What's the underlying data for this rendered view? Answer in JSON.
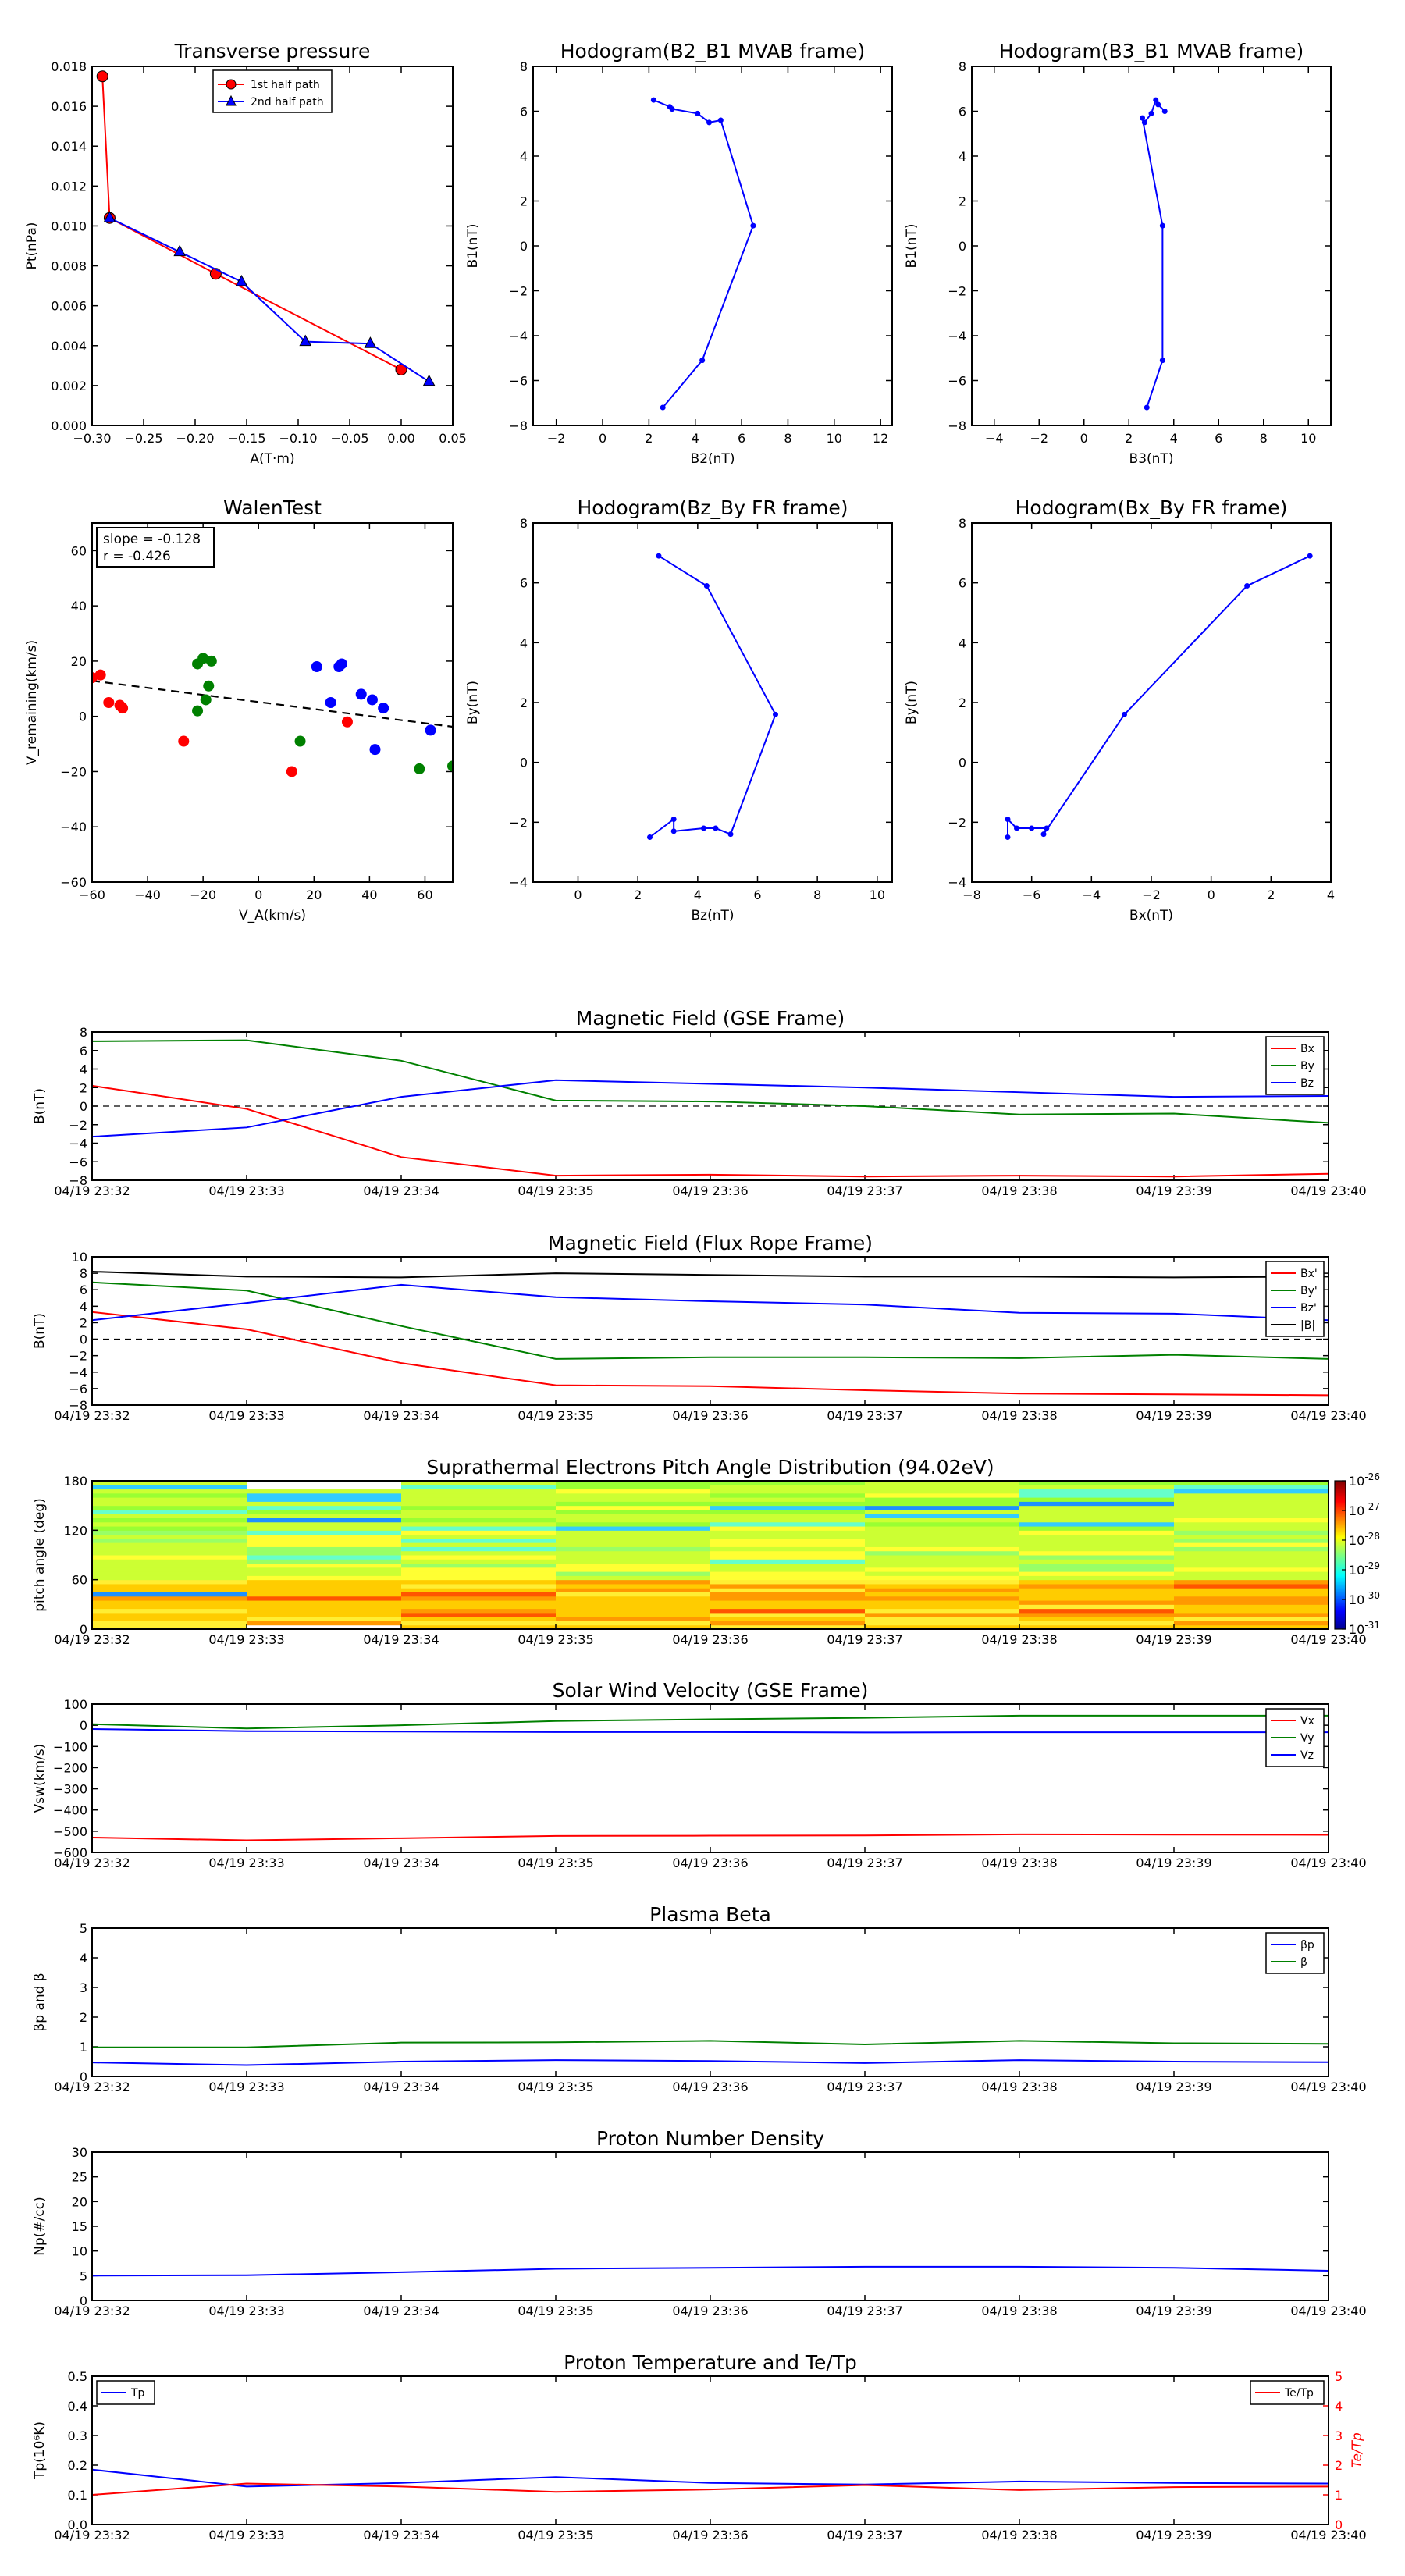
{
  "figure": {
    "time_ticks": [
      "04/19 23:32",
      "04/19 23:33",
      "04/19 23:34",
      "04/19 23:35",
      "04/19 23:36",
      "04/19 23:37",
      "04/19 23:38",
      "04/19 23:39",
      "04/19 23:40"
    ]
  },
  "chart_data": [
    {
      "id": "tp",
      "type": "line",
      "title": "Transverse pressure",
      "xlabel": "A(T·m)",
      "ylabel": "Pt(nPa)",
      "xlim": [
        -0.3,
        0.05
      ],
      "ylim": [
        0,
        0.018
      ],
      "xticks": [
        -0.3,
        -0.25,
        -0.2,
        -0.15,
        -0.1,
        -0.05,
        0.0,
        0.05
      ],
      "xtick_labels": [
        "−0.30",
        "−0.25",
        "−0.20",
        "−0.15",
        "−0.10",
        "−0.05",
        "0.00",
        "0.05"
      ],
      "yticks": [
        0,
        0.002,
        0.004,
        0.006,
        0.008,
        0.01,
        0.012,
        0.014,
        0.016,
        0.018
      ],
      "ytick_labels": [
        "0.000",
        "0.002",
        "0.004",
        "0.006",
        "0.008",
        "0.010",
        "0.012",
        "0.014",
        "0.016",
        "0.018"
      ],
      "legend": "top-center",
      "series": [
        {
          "name": "1st half path",
          "color": "#ff0000",
          "marker": "circle",
          "x": [
            0.0,
            -0.18,
            -0.283,
            -0.29
          ],
          "y": [
            0.0028,
            0.0076,
            0.0104,
            0.0175
          ]
        },
        {
          "name": "2nd half path",
          "color": "#0000ff",
          "marker": "triangle",
          "x": [
            0.027,
            -0.03,
            -0.093,
            -0.155,
            -0.215,
            -0.283
          ],
          "y": [
            0.0022,
            0.0041,
            0.0042,
            0.0072,
            0.0087,
            0.0104
          ]
        }
      ]
    },
    {
      "id": "h21",
      "type": "line",
      "title": "Hodogram(B2_B1 MVAB frame)",
      "xlabel": "B2(nT)",
      "ylabel": "B1(nT)",
      "xlim": [
        -3,
        12.5
      ],
      "ylim": [
        -8,
        8
      ],
      "xticks": [
        -2,
        0,
        2,
        4,
        6,
        8,
        10,
        12
      ],
      "yticks": [
        -8,
        -6,
        -4,
        -2,
        0,
        2,
        4,
        6,
        8
      ],
      "series": [
        {
          "color": "#0000ff",
          "marker": "dot",
          "x": [
            2.2,
            2.9,
            3.0,
            4.1,
            4.6,
            5.1,
            6.5,
            4.3,
            2.6
          ],
          "y": [
            6.5,
            6.2,
            6.1,
            5.9,
            5.5,
            5.6,
            0.9,
            -5.1,
            -7.2
          ]
        }
      ]
    },
    {
      "id": "h31",
      "type": "line",
      "title": "Hodogram(B3_B1 MVAB frame)",
      "xlabel": "B3(nT)",
      "ylabel": "B1(nT)",
      "xlim": [
        -5,
        11
      ],
      "ylim": [
        -8,
        8
      ],
      "xticks": [
        -4,
        -2,
        0,
        2,
        4,
        6,
        8,
        10
      ],
      "yticks": [
        -8,
        -6,
        -4,
        -2,
        0,
        2,
        4,
        6,
        8
      ],
      "series": [
        {
          "color": "#0000ff",
          "marker": "dot",
          "x": [
            3.6,
            3.3,
            3.2,
            3.0,
            2.7,
            2.6,
            3.5,
            3.5,
            2.8
          ],
          "y": [
            6.0,
            6.3,
            6.5,
            5.9,
            5.5,
            5.7,
            0.9,
            -5.1,
            -7.2
          ]
        }
      ]
    },
    {
      "id": "walen",
      "type": "scatter",
      "title": "WalenTest",
      "xlabel": "V_A(km/s)",
      "ylabel": "V_remaining(km/s)",
      "xlim": [
        -60,
        70
      ],
      "ylim": [
        -60,
        70
      ],
      "xticks": [
        -60,
        -40,
        -20,
        0,
        20,
        40,
        60
      ],
      "yticks": [
        -60,
        -40,
        -20,
        0,
        20,
        40,
        60
      ],
      "annotation": [
        "slope = -0.128",
        "r = -0.426"
      ],
      "fit": {
        "slope": -0.128,
        "intercept": 5.2,
        "color": "#000000"
      },
      "series": [
        {
          "color": "#ff0000",
          "x": [
            -60,
            -57,
            -54,
            -50,
            -49,
            -27,
            12,
            32
          ],
          "y": [
            14,
            15,
            5,
            4,
            3,
            -9,
            -20,
            -2
          ]
        },
        {
          "color": "#008000",
          "x": [
            -22,
            -20,
            -18,
            -19,
            -17,
            -22,
            15,
            58,
            70
          ],
          "y": [
            19,
            21,
            11,
            6,
            20,
            2,
            -9,
            -19,
            -18
          ]
        },
        {
          "color": "#0000ff",
          "x": [
            21,
            26,
            29,
            30,
            37,
            41,
            42,
            45,
            62
          ],
          "y": [
            18,
            5,
            18,
            19,
            8,
            6,
            -12,
            3,
            -5
          ]
        }
      ]
    },
    {
      "id": "hzy",
      "type": "line",
      "title": "Hodogram(Bz_By FR frame)",
      "xlabel": "Bz(nT)",
      "ylabel": "By(nT)",
      "xlim": [
        -1.5,
        10.5
      ],
      "ylim": [
        -4,
        8
      ],
      "xticks": [
        0,
        2,
        4,
        6,
        8,
        10
      ],
      "yticks": [
        -4,
        -2,
        0,
        2,
        4,
        6,
        8
      ],
      "series": [
        {
          "color": "#0000ff",
          "marker": "dot",
          "x": [
            2.7,
            4.3,
            6.6,
            5.1,
            4.6,
            4.2,
            3.2,
            3.2,
            2.4
          ],
          "y": [
            6.9,
            5.9,
            1.6,
            -2.4,
            -2.2,
            -2.2,
            -2.3,
            -1.9,
            -2.5
          ]
        }
      ]
    },
    {
      "id": "hxy",
      "type": "line",
      "title": "Hodogram(Bx_By FR frame)",
      "xlabel": "Bx(nT)",
      "ylabel": "By(nT)",
      "xlim": [
        -8,
        4
      ],
      "ylim": [
        -4,
        8
      ],
      "xticks": [
        -8,
        -6,
        -4,
        -2,
        0,
        2,
        4
      ],
      "yticks": [
        -4,
        -2,
        0,
        2,
        4,
        6,
        8
      ],
      "series": [
        {
          "color": "#0000ff",
          "marker": "dot",
          "x": [
            3.3,
            1.2,
            -2.9,
            -5.6,
            -5.5,
            -6.0,
            -6.5,
            -6.8,
            -6.8
          ],
          "y": [
            6.9,
            5.9,
            1.6,
            -2.4,
            -2.2,
            -2.2,
            -2.2,
            -1.9,
            -2.5
          ]
        }
      ]
    },
    {
      "id": "mag_gse",
      "type": "line",
      "title": "Magnetic Field (GSE Frame)",
      "ylabel": "B(nT)",
      "ylim": [
        -8,
        8
      ],
      "yticks": [
        -8,
        -6,
        -4,
        -2,
        0,
        2,
        4,
        6,
        8
      ],
      "zero_line": true,
      "legend": "top-right",
      "series": [
        {
          "name": "Bx",
          "color": "#ff0000",
          "values": [
            2.2,
            -0.3,
            -5.5,
            -7.5,
            -7.4,
            -7.6,
            -7.5,
            -7.6,
            -7.3
          ]
        },
        {
          "name": "By",
          "color": "#008000",
          "values": [
            7.0,
            7.1,
            4.9,
            0.6,
            0.5,
            0.0,
            -0.9,
            -0.8,
            -1.8
          ]
        },
        {
          "name": "Bz",
          "color": "#0000ff",
          "values": [
            -3.3,
            -2.3,
            1.0,
            2.8,
            2.4,
            2.0,
            1.5,
            1.0,
            1.1
          ]
        }
      ]
    },
    {
      "id": "mag_fr",
      "type": "line",
      "title": "Magnetic Field (Flux Rope Frame)",
      "ylabel": "B(nT)",
      "ylim": [
        -8,
        10
      ],
      "yticks": [
        -8,
        -6,
        -4,
        -2,
        0,
        2,
        4,
        6,
        8,
        10
      ],
      "zero_line": true,
      "legend": "top-right",
      "series": [
        {
          "name": "Bx'",
          "color": "#ff0000",
          "values": [
            3.3,
            1.2,
            -2.9,
            -5.6,
            -5.7,
            -6.2,
            -6.6,
            -6.7,
            -6.8
          ]
        },
        {
          "name": "By'",
          "color": "#008000",
          "values": [
            6.9,
            5.9,
            1.6,
            -2.4,
            -2.2,
            -2.2,
            -2.3,
            -1.9,
            -2.4
          ]
        },
        {
          "name": "Bz'",
          "color": "#0000ff",
          "values": [
            2.3,
            4.4,
            6.6,
            5.1,
            4.6,
            4.2,
            3.2,
            3.1,
            2.3
          ]
        },
        {
          "name": "|B|",
          "color": "#000000",
          "values": [
            8.2,
            7.6,
            7.5,
            8.0,
            7.8,
            7.6,
            7.6,
            7.5,
            7.6
          ]
        }
      ]
    },
    {
      "id": "pad",
      "type": "heatmap",
      "title": "Suprathermal Electrons Pitch Angle Distribution (94.02eV)",
      "ylabel": "pitch angle (deg)",
      "ylim": [
        0,
        180
      ],
      "yticks": [
        0,
        60,
        120,
        180
      ],
      "colorbar_ticks": [
        "-26",
        "-27",
        "-28",
        "-29",
        "-30",
        "-31"
      ]
    },
    {
      "id": "vsw",
      "type": "line",
      "title": "Solar Wind Velocity (GSE Frame)",
      "ylabel": "Vsw(km/s)",
      "ylim": [
        -600,
        100
      ],
      "yticks": [
        -600,
        -500,
        -400,
        -300,
        -200,
        -100,
        0,
        100
      ],
      "tick_minus": "−",
      "legend": "top-right",
      "series": [
        {
          "name": "Vx",
          "color": "#ff0000",
          "values": [
            -530,
            -543,
            -533,
            -522,
            -521,
            -520,
            -515,
            -516,
            -517
          ]
        },
        {
          "name": "Vy",
          "color": "#008000",
          "values": [
            5,
            -15,
            0,
            20,
            28,
            35,
            45,
            45,
            45
          ]
        },
        {
          "name": "Vz",
          "color": "#0000ff",
          "values": [
            -18,
            -28,
            -30,
            -32,
            -32,
            -34,
            -33,
            -33,
            -33
          ]
        }
      ]
    },
    {
      "id": "beta",
      "type": "line",
      "title": "Plasma Beta",
      "ylabel": "βp and β",
      "ylim": [
        0,
        5
      ],
      "yticks": [
        0,
        1,
        2,
        3,
        4,
        5
      ],
      "legend": "top-right",
      "series": [
        {
          "name": "βp",
          "color": "#0000ff",
          "values": [
            0.47,
            0.38,
            0.5,
            0.55,
            0.52,
            0.45,
            0.55,
            0.5,
            0.48
          ]
        },
        {
          "name": "β",
          "color": "#008000",
          "values": [
            0.98,
            0.98,
            1.14,
            1.15,
            1.2,
            1.08,
            1.2,
            1.12,
            1.1
          ]
        }
      ]
    },
    {
      "id": "np",
      "type": "line",
      "title": "Proton Number Density",
      "ylabel": "Np(#/cc)",
      "ylim": [
        0,
        30
      ],
      "yticks": [
        0,
        5,
        10,
        15,
        20,
        25,
        30
      ],
      "series": [
        {
          "color": "#0000ff",
          "values": [
            5.0,
            5.1,
            5.7,
            6.4,
            6.6,
            6.8,
            6.8,
            6.6,
            6.0
          ]
        }
      ]
    },
    {
      "id": "tpr",
      "type": "line",
      "title": "Proton Temperature and Te/Tp",
      "ylabel": "Tp(10⁶K)",
      "ylabel_right": "Te/Tp",
      "ylim": [
        0,
        0.5
      ],
      "yticks": [
        0,
        0.1,
        0.2,
        0.3,
        0.4,
        0.5
      ],
      "ytick_labels": [
        "0.0",
        "0.1",
        "0.2",
        "0.3",
        "0.4",
        "0.5"
      ],
      "ylim_right": [
        0,
        5
      ],
      "yticks_right": [
        0,
        1,
        2,
        3,
        4,
        5
      ],
      "series": [
        {
          "name": "Tp",
          "color": "#0000ff",
          "axis": "left",
          "values": [
            0.185,
            0.128,
            0.14,
            0.16,
            0.14,
            0.135,
            0.145,
            0.14,
            0.138
          ]
        },
        {
          "name": "Te/Tp",
          "color": "#ff0000",
          "axis": "right",
          "values": [
            1.0,
            1.38,
            1.28,
            1.1,
            1.18,
            1.33,
            1.16,
            1.26,
            1.28
          ]
        }
      ]
    }
  ]
}
